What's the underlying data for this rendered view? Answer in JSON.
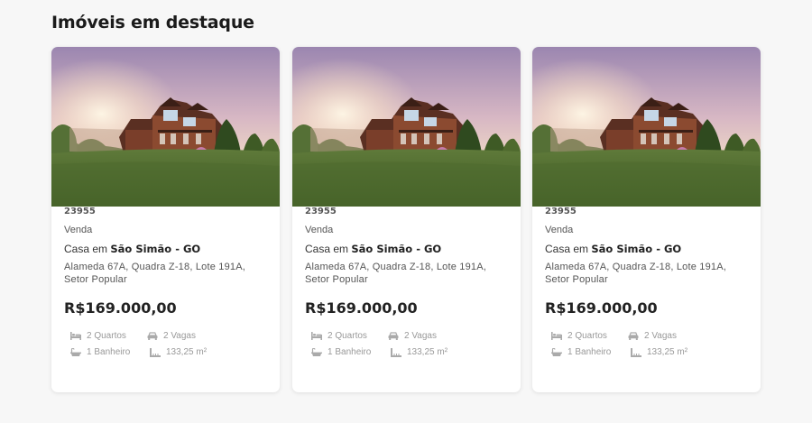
{
  "section": {
    "title": "Imóveis em destaque"
  },
  "colors": {
    "background": "#f7f7f7",
    "card": "#ffffff",
    "text_dark": "#222222",
    "text_muted": "#999999"
  },
  "listings": [
    {
      "code": "23955",
      "type": "Venda",
      "title_prefix": "Casa em",
      "city": "São Simão - GO",
      "address": "Alameda 67A, Quadra Z-18, Lote 191A, Setor Popular",
      "price": "R$169.000,00",
      "features": {
        "bedrooms": "2 Quartos",
        "garage": "2 Vagas",
        "bathrooms": "1 Banheiro",
        "area": "133,25 m²"
      },
      "icons": {
        "bedrooms": "bed-icon",
        "garage": "car-icon",
        "bathrooms": "bathtub-icon",
        "area": "ruler-icon"
      }
    },
    {
      "code": "23955",
      "type": "Venda",
      "title_prefix": "Casa em",
      "city": "São Simão - GO",
      "address": "Alameda 67A, Quadra Z-18, Lote 191A, Setor Popular",
      "price": "R$169.000,00",
      "features": {
        "bedrooms": "2 Quartos",
        "garage": "2 Vagas",
        "bathrooms": "1 Banheiro",
        "area": "133,25 m²"
      },
      "icons": {
        "bedrooms": "bed-icon",
        "garage": "car-icon",
        "bathrooms": "bathtub-icon",
        "area": "ruler-icon"
      }
    },
    {
      "code": "23955",
      "type": "Venda",
      "title_prefix": "Casa em",
      "city": "São Simão - GO",
      "address": "Alameda 67A, Quadra Z-18, Lote 191A, Setor Popular",
      "price": "R$169.000,00",
      "features": {
        "bedrooms": "2 Quartos",
        "garage": "2 Vagas",
        "bathrooms": "1 Banheiro",
        "area": "133,25 m²"
      },
      "icons": {
        "bedrooms": "bed-icon",
        "garage": "car-icon",
        "bathrooms": "bathtub-icon",
        "area": "ruler-icon"
      }
    }
  ]
}
